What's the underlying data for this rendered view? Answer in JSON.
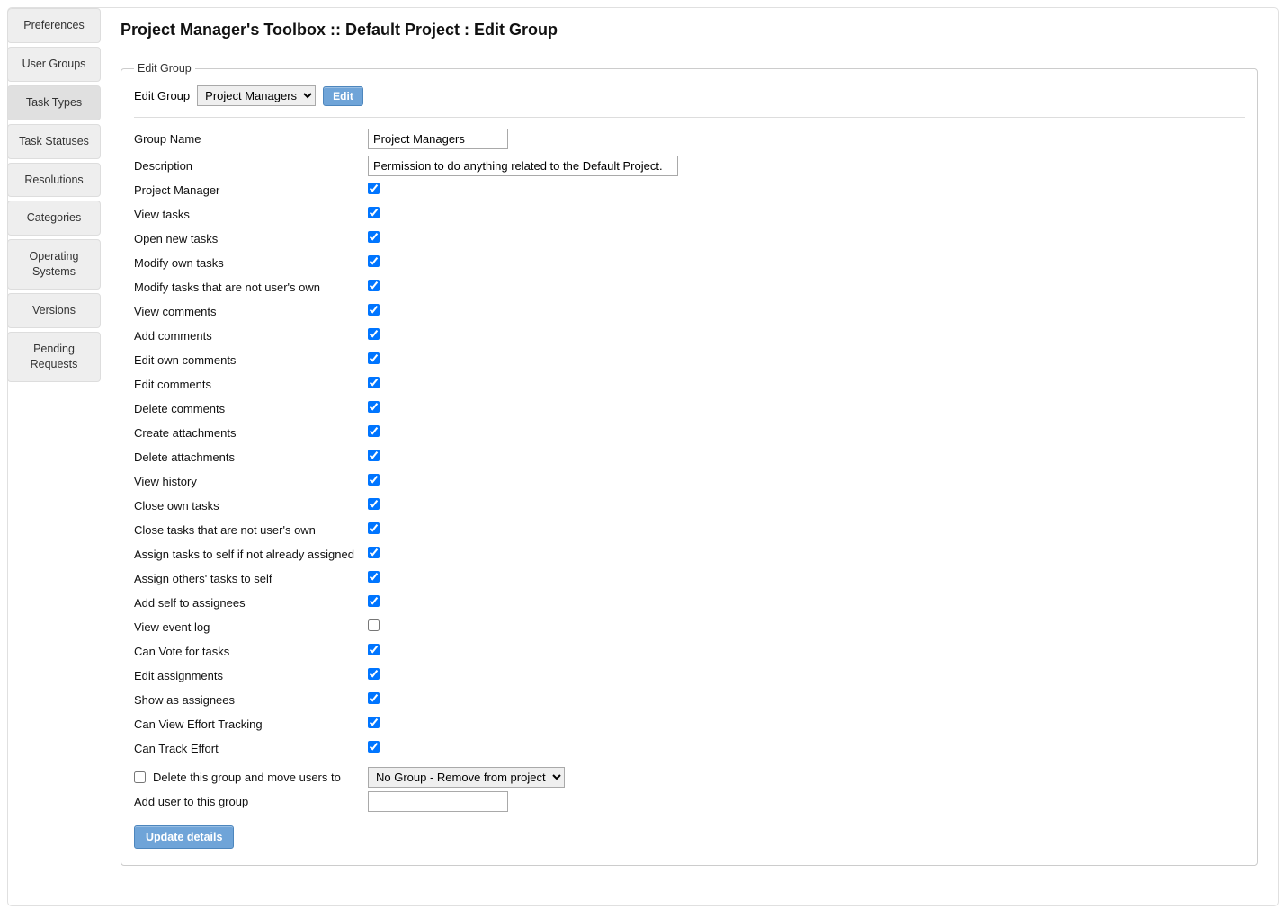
{
  "sidebar": {
    "items": [
      {
        "label": "Preferences"
      },
      {
        "label": "User Groups"
      },
      {
        "label": "Task Types"
      },
      {
        "label": "Task Statuses"
      },
      {
        "label": "Resolutions"
      },
      {
        "label": "Categories"
      },
      {
        "label": "Operating Systems"
      },
      {
        "label": "Versions"
      },
      {
        "label": "Pending Requests"
      }
    ],
    "active_index": 2
  },
  "page": {
    "title": "Project Manager's Toolbox :: Default Project : Edit Group"
  },
  "group_box": {
    "legend": "Edit Group",
    "edit_group_label": "Edit Group",
    "edit_group_select": "Project Managers",
    "edit_button": "Edit"
  },
  "form": {
    "group_name_label": "Group Name",
    "group_name_value": "Project Managers",
    "description_label": "Description",
    "description_value": "Permission to do anything related to the Default Project.",
    "permissions": [
      {
        "label": "Project Manager",
        "checked": true
      },
      {
        "label": "View tasks",
        "checked": true
      },
      {
        "label": "Open new tasks",
        "checked": true
      },
      {
        "label": "Modify own tasks",
        "checked": true
      },
      {
        "label": "Modify tasks that are not user's own",
        "checked": true
      },
      {
        "label": "View comments",
        "checked": true
      },
      {
        "label": "Add comments",
        "checked": true
      },
      {
        "label": "Edit own comments",
        "checked": true
      },
      {
        "label": "Edit comments",
        "checked": true
      },
      {
        "label": "Delete comments",
        "checked": true
      },
      {
        "label": "Create attachments",
        "checked": true
      },
      {
        "label": "Delete attachments",
        "checked": true
      },
      {
        "label": "View history",
        "checked": true
      },
      {
        "label": "Close own tasks",
        "checked": true
      },
      {
        "label": "Close tasks that are not user's own",
        "checked": true
      },
      {
        "label": "Assign tasks to self if not already assigned",
        "checked": true
      },
      {
        "label": "Assign others' tasks to self",
        "checked": true
      },
      {
        "label": "Add self to assignees",
        "checked": true
      },
      {
        "label": "View event log",
        "checked": false
      },
      {
        "label": "Can Vote for tasks",
        "checked": true
      },
      {
        "label": "Edit assignments",
        "checked": true
      },
      {
        "label": "Show as assignees",
        "checked": true
      },
      {
        "label": "Can View Effort Tracking",
        "checked": true
      },
      {
        "label": "Can Track Effort",
        "checked": true
      }
    ],
    "delete_group_label": "Delete this group and move users to",
    "delete_group_checked": false,
    "move_users_select": "No Group - Remove from project",
    "add_user_label": "Add user to this group",
    "add_user_value": "",
    "update_button": "Update details"
  }
}
